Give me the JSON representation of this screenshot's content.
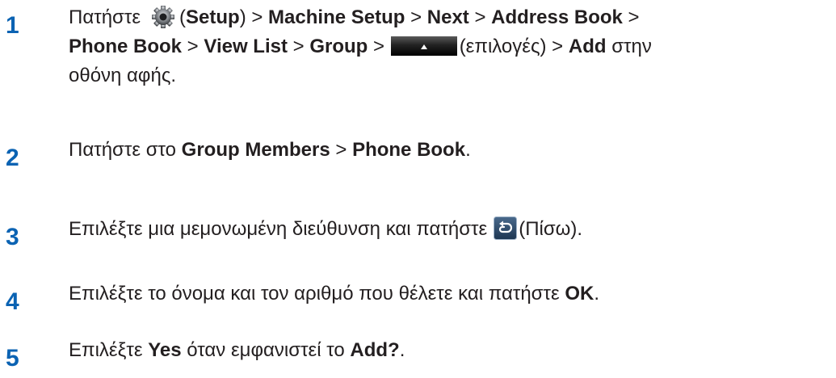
{
  "steps": [
    {
      "number": "1",
      "l1_a": "Πατήστε",
      "l1_b": "(",
      "l1_setup": "Setup",
      "l1_c": ") > ",
      "l1_machine": "Machine Setup",
      "l1_d": " > ",
      "l1_next": "Next",
      "l1_e": " > ",
      "l1_address": "Address Book",
      "l1_f": " >",
      "l2_phone": "Phone Book",
      "l2_a": " > ",
      "l2_view": "View List",
      "l2_b": " > ",
      "l2_group": "Group",
      "l2_c": " > ",
      "l2_d": "(επιλογές) > ",
      "l2_add": "Add",
      "l2_e": " στην",
      "l3": "οθόνη αφής."
    },
    {
      "number": "2",
      "a": "Πατήστε στο ",
      "group_members": "Group Members",
      "b": " > ",
      "phone_book": "Phone Book",
      "c": "."
    },
    {
      "number": "3",
      "a": "Επιλέξτε μια μεμονωμένη διεύθυνση και πατήστε",
      "b": "(Πίσω)."
    },
    {
      "number": "4",
      "a": "Επιλέξτε το όνομα και τον αριθμό που θέλετε και πατήστε ",
      "ok": "OK",
      "b": "."
    },
    {
      "number": "5",
      "a": "Επιλέξτε ",
      "yes": "Yes",
      "b": " όταν εμφανιστεί το ",
      "add": "Add?",
      "c": "."
    }
  ],
  "icons": {
    "setup": "gear-icon",
    "options": "options-up-arrow-icon",
    "back": "back-arrow-icon"
  }
}
